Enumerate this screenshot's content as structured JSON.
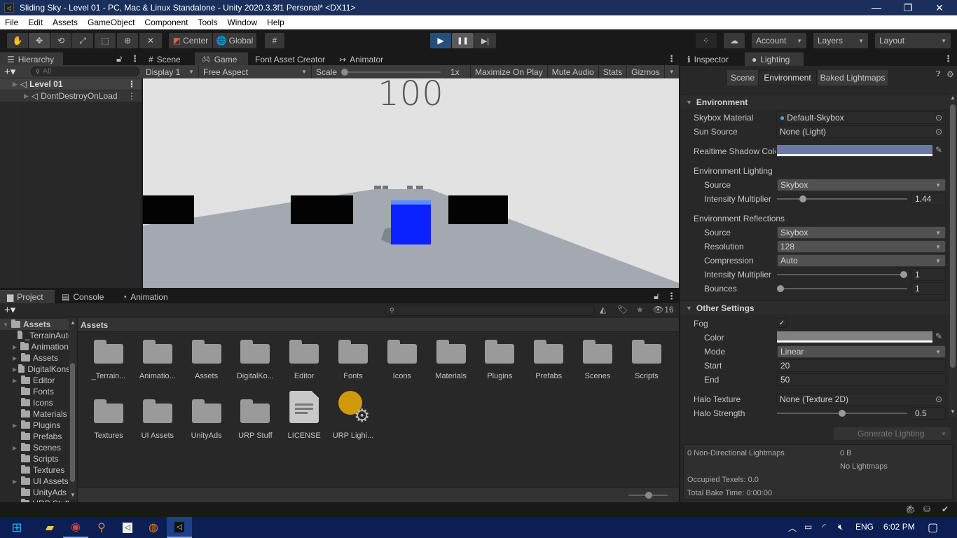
{
  "window": {
    "title": "Sliding Sky - Level 01 - PC, Mac & Linux Standalone - Unity 2020.3.3f1 Personal* <DX11>",
    "controls": {
      "minimize": "—",
      "restore": "❐",
      "close": "✕"
    }
  },
  "menu": [
    "File",
    "Edit",
    "Assets",
    "GameObject",
    "Component",
    "Tools",
    "Window",
    "Help"
  ],
  "toolbar": {
    "tools": [
      "hand-tool",
      "move-tool",
      "rotate-tool",
      "scale-tool",
      "rect-tool",
      "transform-tool",
      "custom-tool"
    ],
    "pivot_label": "Center",
    "space_label": "Global",
    "play_icon": "▶",
    "pause_icon": "❚❚",
    "step_icon": "▶|",
    "account_label": "Account",
    "layers_label": "Layers",
    "layout_label": "Layout"
  },
  "hierarchy": {
    "tab_label": "Hierarchy",
    "search_placeholder": "All",
    "items": [
      {
        "label": "Level 01"
      },
      {
        "label": "DontDestroyOnLoad"
      }
    ]
  },
  "center_tabs": [
    {
      "label": "Scene",
      "icon": "#"
    },
    {
      "label": "Game",
      "icon": "🎮"
    },
    {
      "label": "Font Asset Creator",
      "icon": ""
    },
    {
      "label": "Animator",
      "icon": "↣"
    }
  ],
  "game_toolbar": {
    "display": "Display 1",
    "aspect": "Free Aspect",
    "scale_label": "Scale",
    "scale_value": "1x",
    "maximize": "Maximize On Play",
    "mute": "Mute Audio",
    "stats": "Stats",
    "gizmos": "Gizmos"
  },
  "game_view": {
    "score": "100",
    "colors": {
      "sky": "#e2e2e2",
      "ground": "#a3a8b1",
      "player": "#0a22ff",
      "obstacle": "#000000"
    }
  },
  "inspector": {
    "tabs": [
      {
        "label": "Inspector",
        "icon": "ℹ"
      },
      {
        "label": "Lighting",
        "icon": "💡"
      }
    ],
    "subtabs": [
      "Scene",
      "Environment",
      "Baked Lightmaps"
    ],
    "environment": {
      "header": "Environment",
      "skybox_material_label": "Skybox Material",
      "skybox_material_value": "Default-Skybox",
      "sun_source_label": "Sun Source",
      "sun_source_value": "None (Light)",
      "shadow_color_label": "Realtime Shadow Color",
      "shadow_color": "#6b7aa3",
      "env_lighting_label": "Environment Lighting",
      "source_label": "Source",
      "source_value": "Skybox",
      "intensity_label": "Intensity Multiplier",
      "intensity_value": "1.44",
      "intensity_fraction": 0.18,
      "env_reflections_label": "Environment Reflections",
      "refl_source_label": "Source",
      "refl_source_value": "Skybox",
      "resolution_label": "Resolution",
      "resolution_value": "128",
      "compression_label": "Compression",
      "compression_value": "Auto",
      "refl_intensity_label": "Intensity Multiplier",
      "refl_intensity_value": "1",
      "refl_intensity_fraction": 1.0,
      "bounces_label": "Bounces",
      "bounces_value": "1",
      "bounces_fraction": 0.0
    },
    "other": {
      "header": "Other Settings",
      "fog_label": "Fog",
      "fog_checked": true,
      "color_label": "Color",
      "fog_color": "#808080",
      "mode_label": "Mode",
      "mode_value": "Linear",
      "start_label": "Start",
      "start_value": "20",
      "end_label": "End",
      "end_value": "50",
      "halo_texture_label": "Halo Texture",
      "halo_texture_value": "None (Texture 2D)",
      "halo_strength_label": "Halo Strength",
      "halo_strength_value": "0.5",
      "halo_strength_fraction": 0.5
    },
    "generate_label": "Generate Lighting",
    "stats": {
      "lightmaps": "0 Non-Directional Lightmaps",
      "size": "0 B",
      "no_lightmaps": "No Lightmaps",
      "texels": "Occupied Texels: 0.0",
      "bake_time": "Total Bake Time: 0:00:00"
    }
  },
  "project": {
    "tabs": [
      {
        "label": "Project"
      },
      {
        "label": "Console"
      },
      {
        "label": "Animation"
      }
    ],
    "hidden_count": "16",
    "breadcrumb": "Assets",
    "tree": [
      {
        "label": "Assets",
        "expandable": true,
        "root": true
      },
      {
        "label": "_TerrainAutoUpgrade",
        "expandable": false
      },
      {
        "label": "Animations",
        "expandable": true
      },
      {
        "label": "Assets",
        "expandable": true
      },
      {
        "label": "DigitalKonstrukt",
        "expandable": true
      },
      {
        "label": "Editor",
        "expandable": true
      },
      {
        "label": "Fonts",
        "expandable": false
      },
      {
        "label": "Icons",
        "expandable": false
      },
      {
        "label": "Materials",
        "expandable": false
      },
      {
        "label": "Plugins",
        "expandable": true
      },
      {
        "label": "Prefabs",
        "expandable": false
      },
      {
        "label": "Scenes",
        "expandable": true
      },
      {
        "label": "Scripts",
        "expandable": false
      },
      {
        "label": "Textures",
        "expandable": false
      },
      {
        "label": "UI Assets",
        "expandable": true
      },
      {
        "label": "UnityAds",
        "expandable": false
      },
      {
        "label": "URP Stuff",
        "expandable": false
      }
    ],
    "grid": [
      {
        "label": "_Terrain...",
        "type": "folder"
      },
      {
        "label": "Animatio...",
        "type": "folder"
      },
      {
        "label": "Assets",
        "type": "folder"
      },
      {
        "label": "DigitalKo...",
        "type": "folder"
      },
      {
        "label": "Editor",
        "type": "folder"
      },
      {
        "label": "Fonts",
        "type": "folder"
      },
      {
        "label": "Icons",
        "type": "folder"
      },
      {
        "label": "Materials",
        "type": "folder"
      },
      {
        "label": "Plugins",
        "type": "folder"
      },
      {
        "label": "Prefabs",
        "type": "folder"
      },
      {
        "label": "Scenes",
        "type": "folder"
      },
      {
        "label": "Scripts",
        "type": "folder"
      },
      {
        "label": "Textures",
        "type": "folder"
      },
      {
        "label": "UI Assets",
        "type": "folder"
      },
      {
        "label": "UnityAds",
        "type": "folder"
      },
      {
        "label": "URP Stuff",
        "type": "folder"
      },
      {
        "label": "LICENSE",
        "type": "text"
      },
      {
        "label": "URP Lighi...",
        "type": "lighting"
      }
    ]
  },
  "taskbar": {
    "apps": [
      "start",
      "file-explorer",
      "chrome",
      "search-app",
      "unity-hub",
      "blender",
      "unity-editor"
    ],
    "language": "ENG",
    "time": "6:02 PM"
  }
}
